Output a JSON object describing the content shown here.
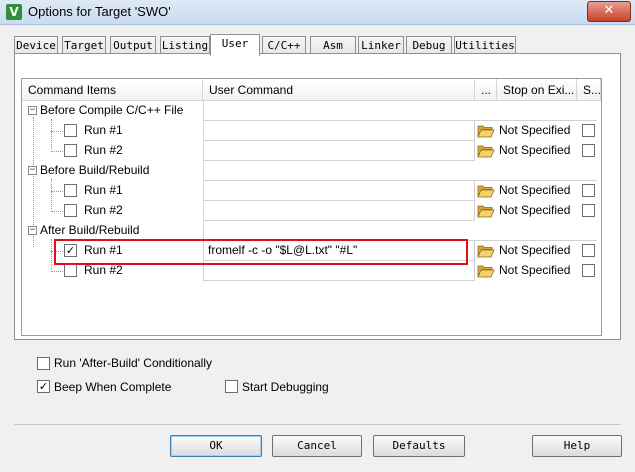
{
  "window": {
    "title": "Options for Target 'SWO'",
    "close_glyph": "✕",
    "app_icon_glyph": "V"
  },
  "tabs": [
    {
      "label": "Device"
    },
    {
      "label": "Target"
    },
    {
      "label": "Output"
    },
    {
      "label": "Listing"
    },
    {
      "label": "User"
    },
    {
      "label": "C/C++"
    },
    {
      "label": "Asm"
    },
    {
      "label": "Linker"
    },
    {
      "label": "Debug"
    },
    {
      "label": "Utilities"
    }
  ],
  "active_tab": "User",
  "grid": {
    "columns": {
      "items": "Command Items",
      "cmd": "User Command",
      "browse": "...",
      "stop": "Stop on Exi...",
      "s": "S..."
    },
    "groups": [
      {
        "label": "Before Compile C/C++ File",
        "expander": "−",
        "runs": [
          {
            "label": "Run #1",
            "checked": false,
            "command": "",
            "stop": "Not Specified"
          },
          {
            "label": "Run #2",
            "checked": false,
            "command": "",
            "stop": "Not Specified"
          }
        ]
      },
      {
        "label": "Before Build/Rebuild",
        "expander": "−",
        "runs": [
          {
            "label": "Run #1",
            "checked": false,
            "command": "",
            "stop": "Not Specified"
          },
          {
            "label": "Run #2",
            "checked": false,
            "command": "",
            "stop": "Not Specified"
          }
        ]
      },
      {
        "label": "After Build/Rebuild",
        "expander": "−",
        "runs": [
          {
            "label": "Run #1",
            "checked": true,
            "command": "fromelf -c -o \"$L@L.txt\" \"#L\"",
            "stop": "Not Specified"
          },
          {
            "label": "Run #2",
            "checked": false,
            "command": "",
            "stop": "Not Specified"
          }
        ]
      }
    ]
  },
  "options": {
    "run_after_build": {
      "label": "Run 'After-Build' Conditionally",
      "checked": false
    },
    "beep": {
      "label": "Beep When Complete",
      "checked": true
    },
    "start_debug": {
      "label": "Start Debugging",
      "checked": false
    }
  },
  "buttons": {
    "ok": "OK",
    "cancel": "Cancel",
    "defaults": "Defaults",
    "help": "Help"
  },
  "check_glyph": "✓",
  "highlight_color": "#e0101a"
}
